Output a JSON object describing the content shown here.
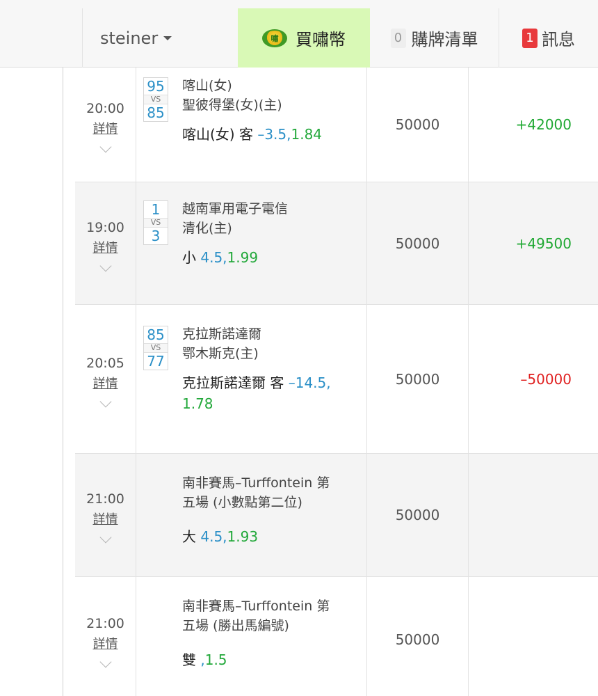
{
  "header": {
    "username": "steiner",
    "buy_coin_label": "買嘯幣",
    "coin_icon_text": "嘯",
    "cart_count": "0",
    "cart_label": "購牌清單",
    "msg_count": "1",
    "msg_label": "訊息"
  },
  "rows": [
    {
      "time": "20:00",
      "detail": "詳情",
      "score_home": "95",
      "vs": "VS",
      "score_away": "85",
      "team1": "喀山(女)",
      "team2": "聖彼得堡(女)(主)",
      "pick_name": "喀山(女) 客",
      "pick_line": "–3.5,",
      "pick_odds": "1.84",
      "stake": "50000",
      "result": "+42000"
    },
    {
      "time": "19:00",
      "detail": "詳情",
      "score_home": "1",
      "vs": "VS",
      "score_away": "3",
      "team1": "越南軍用電子電信",
      "team2": "清化(主)",
      "pick_name": "小",
      "pick_line": "4.5,",
      "pick_odds": "1.99",
      "stake": "50000",
      "result": "+49500"
    },
    {
      "time": "20:05",
      "detail": "詳情",
      "score_home": "85",
      "vs": "VS",
      "score_away": "77",
      "team1": "克拉斯諾達爾",
      "team2": "鄂木斯克(主)",
      "pick_name": "克拉斯諾達爾 客",
      "pick_line": "–14.5,",
      "pick_odds": "1.78",
      "stake": "50000",
      "result": "–50000"
    },
    {
      "time": "21:00",
      "detail": "詳情",
      "race_line1": "南非賽馬–Turffontein 第",
      "race_line2": "五場 (小數點第二位)",
      "pick_name": "大",
      "pick_line": "4.5,",
      "pick_odds": "1.93",
      "stake": "50000",
      "result": ""
    },
    {
      "time": "21:00",
      "detail": "詳情",
      "race_line1": "南非賽馬–Turffontein 第",
      "race_line2": "五場 (勝出馬編號)",
      "pick_name": "雙",
      "pick_line": ",",
      "pick_odds": "1.5",
      "stake": "50000",
      "result": ""
    }
  ]
}
